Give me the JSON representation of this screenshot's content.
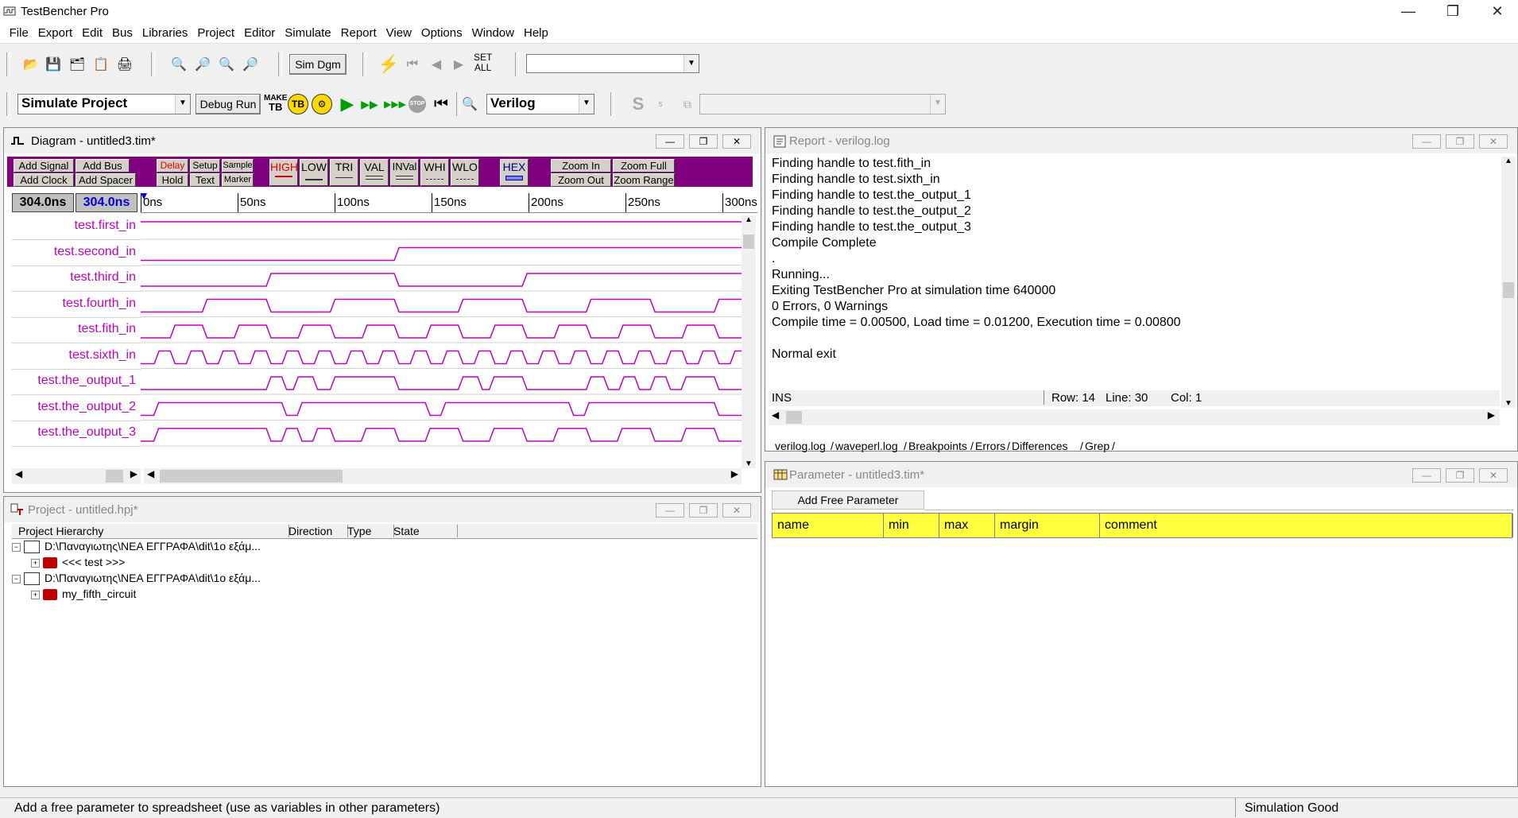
{
  "app": {
    "title": "TestBencher Pro"
  },
  "window_controls": {
    "minimize": "—",
    "restore": "❐",
    "close": "✕"
  },
  "menu": [
    "File",
    "Export",
    "Edit",
    "Bus",
    "Libraries",
    "Project",
    "Editor",
    "Simulate",
    "Report",
    "View",
    "Options",
    "Window",
    "Help"
  ],
  "toolbar1": {
    "sim_dgm": "Sim Dgm",
    "set_all_1": "SET",
    "set_all_2": "ALL",
    "combo_value": ""
  },
  "toolbar2": {
    "sim_project": "Simulate Project",
    "debug_run": "Debug Run",
    "make_tb_1": "MAKE",
    "make_tb_2": "TB",
    "tb": "TB",
    "stop": "STOP",
    "language": "Verilog",
    "combo2_value": ""
  },
  "diagram": {
    "title": "Diagram - untitled3.tim*",
    "buttons": {
      "add_signal": "Add Signal",
      "add_bus": "Add Bus",
      "add_clock": "Add Clock",
      "add_spacer": "Add Spacer",
      "delay": "Delay",
      "setup": "Setup",
      "sample": "Sample",
      "hold": "Hold",
      "text": "Text",
      "marker": "Marker",
      "high": "HIGH",
      "low": "LOW",
      "tri": "TRI",
      "val": "VAL",
      "inval": "INVal",
      "whi": "WHI",
      "wlo": "WLO",
      "hex": "HEX",
      "zoom_in": "Zoom In",
      "zoom_full": "Zoom Full",
      "zoom_out": "Zoom Out",
      "zoom_range": "Zoom Range"
    },
    "time_left": "304.0ns",
    "time_right": "304.0ns",
    "ticks": [
      "0ns",
      "50ns",
      "100ns",
      "150ns",
      "200ns",
      "250ns",
      "300ns"
    ],
    "signals": [
      "test.first_in",
      "test.second_in",
      "test.third_in",
      "test.fourth_in",
      "test.fith_in",
      "test.sixth_in",
      "test.the_output_1",
      "test.the_output_2",
      "test.the_output_3"
    ]
  },
  "report": {
    "title": "Report - verilog.log",
    "lines": [
      "Finding handle to test.fith_in",
      "Finding handle to test.sixth_in",
      "Finding handle to test.the_output_1",
      "Finding handle to test.the_output_2",
      "Finding handle to test.the_output_3",
      "Compile Complete",
      ".",
      "Running...",
      "Exiting TestBencher Pro at simulation time 640000",
      "0 Errors, 0 Warnings",
      "Compile time = 0.00500, Load time = 0.01200, Execution time = 0.00800",
      "",
      "Normal exit"
    ],
    "status_ins": "INS",
    "status_row": "Row: 14",
    "status_line": "Line: 30",
    "status_col": "Col: 1",
    "tabs": [
      "verilog.log",
      "waveperl.log",
      "Breakpoints",
      "Errors",
      "Differences",
      "Grep"
    ]
  },
  "project": {
    "title": "Project - untitled.hpj*",
    "columns": [
      "Project Hierarchy",
      "Direction",
      "Type",
      "State"
    ],
    "tree": [
      {
        "label": "D:\\Παναγιωτης\\ΝΕΑ ΕΓΓΡΑΦΑ\\dit\\1ο εξάμ...",
        "level": 0
      },
      {
        "label": "<<< test >>>",
        "level": 1
      },
      {
        "label": "D:\\Παναγιωτης\\ΝΕΑ ΕΓΓΡΑΦΑ\\dit\\1ο εξάμ...",
        "level": 0
      },
      {
        "label": "my_fifth_circuit",
        "level": 1
      }
    ]
  },
  "parameter": {
    "title": "Parameter - untitled3.tim*",
    "add_button": "Add Free Parameter",
    "columns": [
      "name",
      "min",
      "max",
      "margin",
      "comment"
    ]
  },
  "statusbar": {
    "message": "Add a free parameter to spreadsheet (use as variables in other parameters)",
    "sim_status": "Simulation Good"
  },
  "colors": {
    "wave": "#c000c0",
    "diagbar": "#800080",
    "param_header": "#ffff40"
  }
}
